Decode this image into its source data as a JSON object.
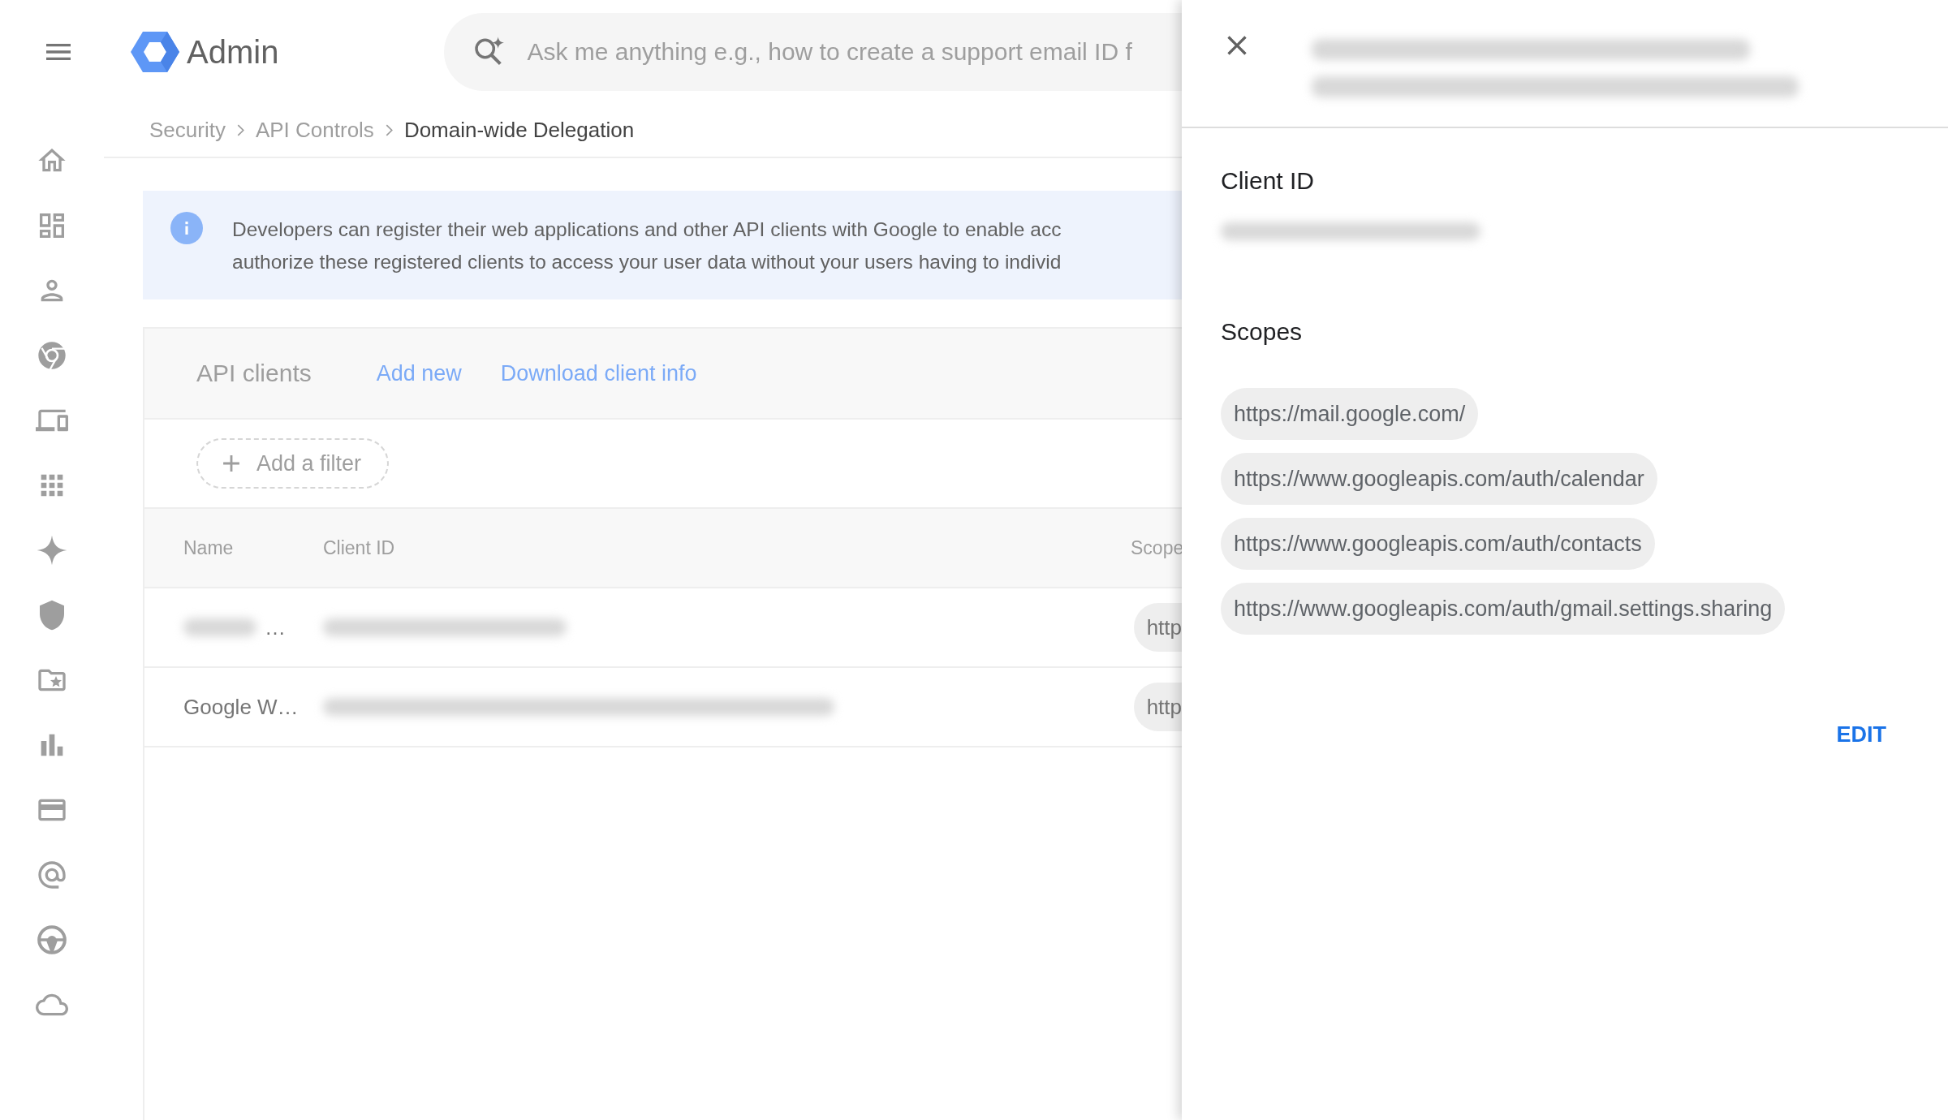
{
  "header": {
    "app_name": "Admin",
    "search": {
      "placeholder": "Ask me anything e.g., how to create a support email ID f"
    }
  },
  "breadcrumb": [
    {
      "label": "Security"
    },
    {
      "label": "API Controls"
    },
    {
      "label": "Domain-wide Delegation"
    }
  ],
  "info_banner": {
    "lines": [
      "Developers can register their web applications and other API clients with Google to enable acc",
      "authorize these registered clients to access your user data without your users having to individ"
    ]
  },
  "api_clients": {
    "title": "API clients",
    "actions": [
      "Add new",
      "Download client info"
    ],
    "filter_button": "Add a filter",
    "columns": [
      "Name",
      "Client ID",
      "Scope"
    ],
    "rows": [
      {
        "name": "…",
        "scope": "http"
      },
      {
        "name": "Google W…",
        "scope": "http"
      }
    ]
  },
  "panel": {
    "client_id_label": "Client ID",
    "scopes_label": "Scopes",
    "scopes": [
      "https://mail.google.com/",
      "https://www.googleapis.com/auth/calendar",
      "https://www.googleapis.com/auth/contacts",
      "https://www.googleapis.com/auth/gmail.settings.sharing"
    ],
    "edit_button": "EDIT"
  }
}
